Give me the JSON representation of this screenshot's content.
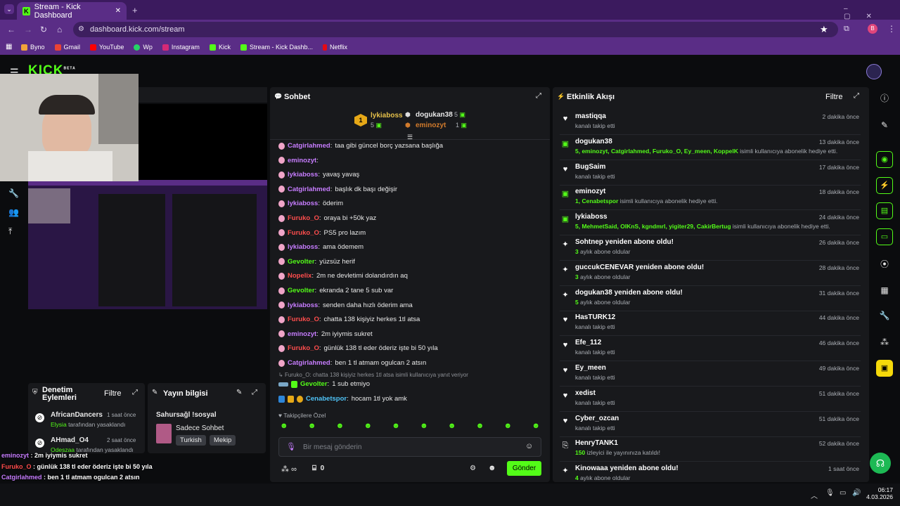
{
  "browser": {
    "tab_title": "Stream - Kick Dashboard",
    "url": "dashboard.kick.com/stream",
    "profile_initial": "B",
    "bookmarks": [
      "Byno",
      "Gmail",
      "YouTube",
      "Wp",
      "Instagram",
      "Kick",
      "Stream - Kick Dashb...",
      "Netflix"
    ]
  },
  "kick": {
    "logo": "KICK",
    "beta": "BETA"
  },
  "mod": {
    "title": "Denetim Eylemleri",
    "filter": "Filtre",
    "items": [
      {
        "user": "AfricanDancers",
        "time": "1 saat önce",
        "by": "Elysia",
        "action": "tarafından yasaklandı"
      },
      {
        "user": "AHmad_O4",
        "time": "2 saat önce",
        "by": "Odeszaa",
        "action": "tarafından yasaklandı"
      }
    ]
  },
  "info": {
    "title": "Yayın bilgisi",
    "stream_title": "Sahursağl !sosyal",
    "mode": "Sadece Sohbet",
    "tags": [
      "Turkish",
      "Mekip"
    ]
  },
  "chat": {
    "title": "Sohbet",
    "top": [
      {
        "rank": "1",
        "name": "lykiaboss",
        "count": "5"
      },
      {
        "rank": "2",
        "name": "dogukan38",
        "count": "5"
      },
      {
        "rank": "3",
        "name": "eminozyt",
        "count": "1"
      }
    ],
    "messages": [
      {
        "user": "Catgirlahmed",
        "color": "#c77dff",
        "text": "taa gibi güncel borç yazsana başlığa"
      },
      {
        "user": "eminozyt",
        "color": "#c77dff",
        "text": ""
      },
      {
        "user": "lykiaboss",
        "color": "#c77dff",
        "text": "yavaş yavaş"
      },
      {
        "user": "Catgirlahmed",
        "color": "#c77dff",
        "text": "başlık dk başı değişir"
      },
      {
        "user": "lykiaboss",
        "color": "#c77dff",
        "text": "öderim"
      },
      {
        "user": "Furuko_O",
        "color": "#ff4d4d",
        "text": "oraya bi +50k yaz"
      },
      {
        "user": "Furuko_O",
        "color": "#ff4d4d",
        "text": "PS5 pro lazım"
      },
      {
        "user": "lykiaboss",
        "color": "#c77dff",
        "text": "ama ödemem"
      },
      {
        "user": "Gevolter",
        "color": "#53fc18",
        "text": "yüzsüz herif"
      },
      {
        "user": "Nopelix",
        "color": "#ff4d4d",
        "text": "2m ne devletimi dolandırdın aq"
      },
      {
        "user": "Gevolter",
        "color": "#53fc18",
        "text": "ekranda 2 tane 5 sub var"
      },
      {
        "user": "lykiaboss",
        "color": "#c77dff",
        "text": "senden daha hızlı öderim ama"
      },
      {
        "user": "Furuko_O",
        "color": "#ff4d4d",
        "text": "chatta 138 kişiyiz herkes 1tl atsa"
      },
      {
        "user": "eminozyt",
        "color": "#c77dff",
        "text": "2m iyiymis sukret"
      },
      {
        "user": "Furuko_O",
        "color": "#ff4d4d",
        "text": "günlük 138 tl eder öderiz işte bi 50 yıla"
      },
      {
        "user": "Catgirlahmed",
        "color": "#c77dff",
        "text": "ben 1 tl atmam ogulcan 2 atsın"
      }
    ],
    "reply_hint": "Furuko_O: chatta 138 kişiyiz herkes 1tl atsa isimli kullanıcıya yanıt veriyor",
    "reply": {
      "user": "Gevolter",
      "color": "#53fc18",
      "text": "1 sub etmiyo"
    },
    "last": {
      "user": "Cenabetspor",
      "color": "#4fc3f7",
      "text": "hocam 1tl yok amk"
    },
    "emote_label": "Takipçilere Özel",
    "placeholder": "Bir mesaj gönderin",
    "points": "∞",
    "gifts": "0",
    "send": "Gönder"
  },
  "feed": {
    "title": "Etkinlik Akışı",
    "filter": "Filtre",
    "items": [
      {
        "icon": "heart",
        "user": "mastiqqa",
        "desc": "kanalı takip etti",
        "green": "",
        "time": "2 dakika önce"
      },
      {
        "icon": "gift",
        "user": "dogukan38",
        "green": "5, eminozyt, Catgirlahmed, Furuko_O, Ey_meen, KoppelK",
        "desc": " isimli kullanıcıya abonelik hediye etti.",
        "time": "13 dakika önce"
      },
      {
        "icon": "heart",
        "user": "BugSaim",
        "desc": "kanalı takip etti",
        "green": "",
        "time": "17 dakika önce"
      },
      {
        "icon": "gift",
        "user": "eminozyt",
        "green": "1, Cenabetspor",
        "desc": " isimli kullanıcıya abonelik hediye etti.",
        "time": "18 dakika önce"
      },
      {
        "icon": "gift",
        "user": "lykiaboss",
        "green": "5, MehmetSaid, OIKnS, kgndmrl, yigiter29, CakirBertug",
        "desc": " isimli kullanıcıya abonelik hediye etti.",
        "time": "24 dakika önce"
      },
      {
        "icon": "star",
        "user": "Sohtnep yeniden abone oldu!",
        "green": "3",
        "desc": " aylık abone oldular",
        "time": "26 dakika önce"
      },
      {
        "icon": "star",
        "user": "guccukCENEVAR yeniden abone oldu!",
        "green": "3",
        "desc": " aylık abone oldular",
        "time": "28 dakika önce"
      },
      {
        "icon": "star",
        "user": "dogukan38 yeniden abone oldu!",
        "green": "5",
        "desc": " aylık abone oldular",
        "time": "31 dakika önce"
      },
      {
        "icon": "heart",
        "user": "HasTURK12",
        "desc": "kanalı takip etti",
        "green": "",
        "time": "44 dakika önce"
      },
      {
        "icon": "heart",
        "user": "Efe_112",
        "desc": "kanalı takip etti",
        "green": "",
        "time": "46 dakika önce"
      },
      {
        "icon": "heart",
        "user": "Ey_meen",
        "desc": "kanalı takip etti",
        "green": "",
        "time": "49 dakika önce"
      },
      {
        "icon": "heart",
        "user": "xedist",
        "desc": "kanalı takip etti",
        "green": "",
        "time": "51 dakika önce"
      },
      {
        "icon": "heart",
        "user": "Cyber_ozcan",
        "desc": "kanalı takip etti",
        "green": "",
        "time": "51 dakika önce"
      },
      {
        "icon": "host",
        "user": "HenryTANK1",
        "green": "150",
        "desc": " izleyici ile yayınınıza katıldı!",
        "time": "52 dakika önce"
      },
      {
        "icon": "star",
        "user": "Kinowaaa yeniden abone oldu!",
        "green": "4",
        "desc": " aylık abone oldular",
        "time": "1 saat önce"
      }
    ]
  },
  "overlay": [
    {
      "user": "eminozyt",
      "color": "#c77dff",
      "text": "2m iyiymis sukret"
    },
    {
      "user": "Furuko_O",
      "color": "#ff4d4d",
      "text": "günlük 138 tl eder öderiz işte bi 50 yıla"
    },
    {
      "user": "Catgirlahmed",
      "color": "#c77dff",
      "text": "ben 1 tl atmam ogulcan 2 atsın"
    },
    {
      "user": "Gevolter",
      "color": "#53fc18",
      "text": "1 sub etmiyo"
    },
    {
      "user": "Cenabetspor",
      "color": "#4fc3f7",
      "text": "hocam 1tl yok amk"
    }
  ],
  "taskbar": {
    "time": "06:17",
    "date": "4.03.2026"
  }
}
